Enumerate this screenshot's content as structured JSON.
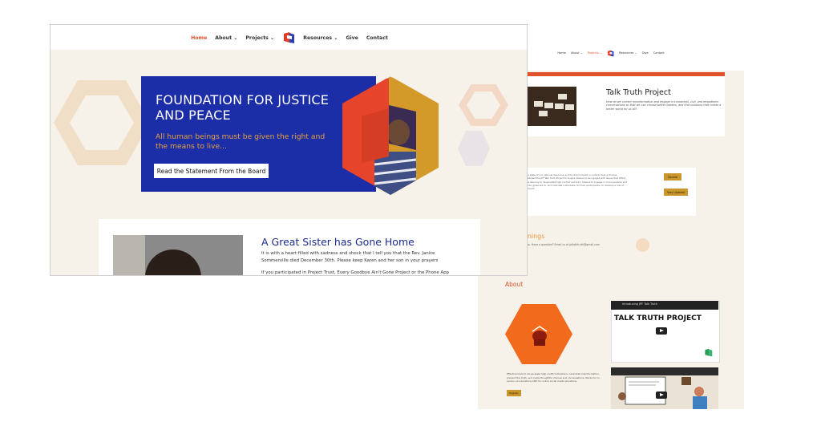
{
  "front": {
    "nav": {
      "home": "Home",
      "about": "About",
      "projects": "Projects",
      "resources": "Resources",
      "give": "Give",
      "contact": "Contact",
      "dropdown_glyph": "⌄"
    },
    "hero": {
      "title": "FOUNDATION FOR JUSTICE AND PEACE",
      "subtitle": "All human beings must be given the right and the means to live...",
      "button": "Read the Statement From the Board"
    },
    "post": {
      "title": "A Great Sister has Gone Home",
      "paragraph1": "It is with a heart filled with sadness and shock that I tell you that the Rev. Janice Sommerville died December 30th. Please keep Karen and her son in your prayers",
      "paragraph2": "If you participated in Project Trust, Every Goodbye Ain't Gone Project or the Phone App project you"
    }
  },
  "back": {
    "nav": {
      "home": "Home",
      "about": "About",
      "projects": "Projects",
      "resources": "Resources",
      "give": "Give",
      "contact": "Contact"
    },
    "talk_truth": {
      "title": "Talk Truth Project",
      "description": "How do we correct misinformation and engage in connected, civil, and empathetic conversations so that we can choose better leaders, and find solutions that create a better world for us all?"
    },
    "mission": {
      "text": "eply concerned about the state of our national discourse and its direct impact on voters' lives g choices. Therefore, we have established the JPF Talk Truth Project to inspire citizens to be ngaged with issues that affect all our lives. This includes learning to de-escalate high conflict and train citizens to engage in more powerful and effective conversations. Our goals are to: and motivate individuals, (b) train participants, (c) develop a hub of useful content, and (d) impact.",
      "donate": "Donate",
      "stay": "Stay Updated"
    },
    "trainings": {
      "title": "ng Trainings",
      "subtitle": "ble for you and sign up. Have a question? Email us at jpftalktruth@gmail.com"
    },
    "about": {
      "heading": "About",
      "text": "Effective tools to de-escalate high-conflict situations, neutralize misinformation, prevent the truth, and invite thoughtful choices and conversations. Works for in-person conversations AND for online social media situations.",
      "register": "Register"
    },
    "video": {
      "bar_title": "Introducing JPF Talk Truth",
      "title": "TALK TRUTH PROJECT"
    }
  },
  "colors": {
    "accent": "#e0522b",
    "brand_blue": "#1b2ea8",
    "gold": "#c8962a",
    "page_bg": "#f6f1e9"
  }
}
